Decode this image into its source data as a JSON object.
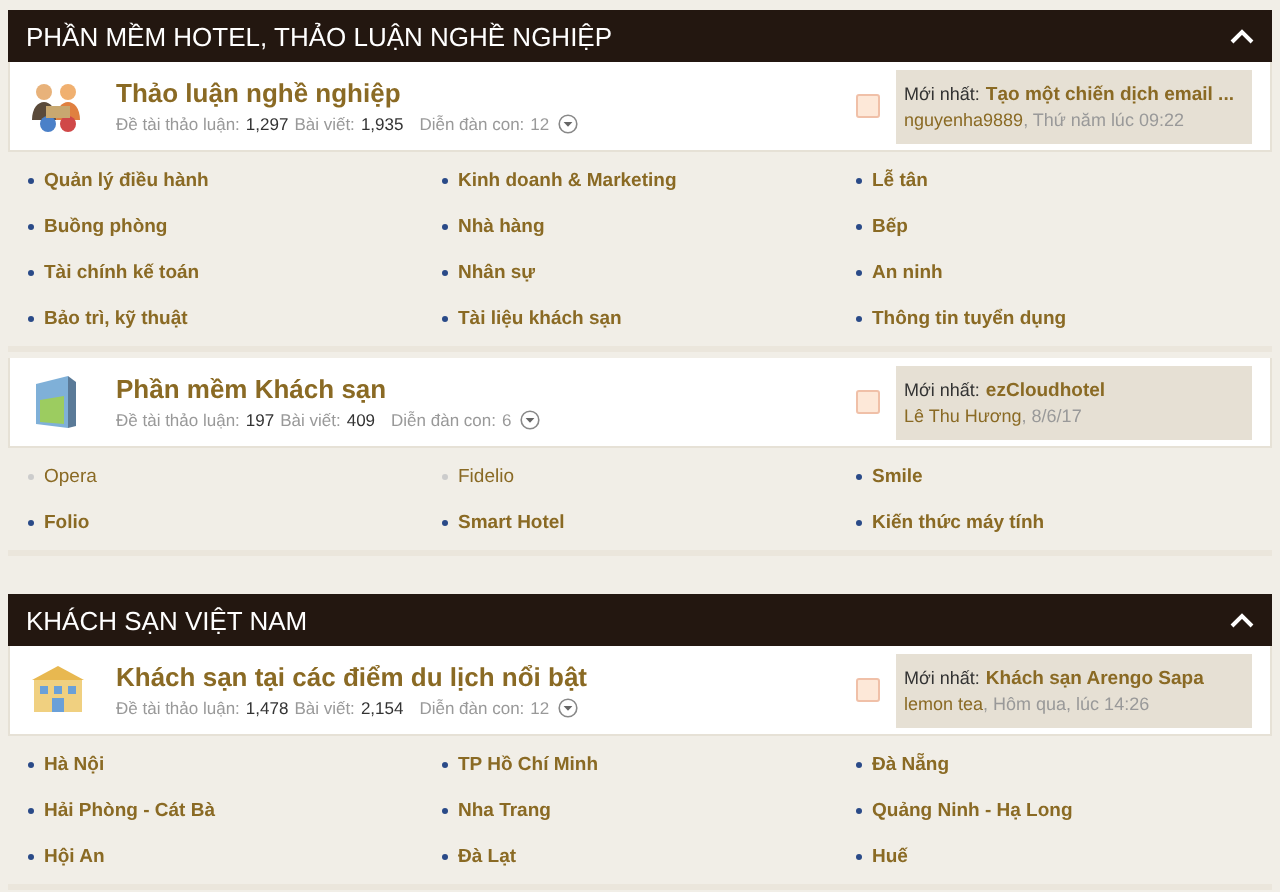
{
  "sections": [
    {
      "title": "PHẦN MỀM HOTEL, THẢO LUẬN NGHỀ NGHIỆP",
      "expanded": true,
      "forums": [
        {
          "kind": "people",
          "title": "Thảo luận nghề nghiệp",
          "stats": {
            "threads_label": "Đề tài thảo luận:",
            "threads": "1,297",
            "posts_label": "Bài viết:",
            "posts": "1,935",
            "subforums_label": "Diễn đàn con:",
            "subforums": "12"
          },
          "latest": {
            "label": "Mới nhất:",
            "title": "Tạo một chiến dịch email ...",
            "user": "nguyenha9889",
            "date": ", Thứ năm lúc 09:22"
          },
          "children": [
            {
              "label": "Quản lý điều hành",
              "unread": true
            },
            {
              "label": "Kinh doanh & Marketing",
              "unread": true
            },
            {
              "label": "Lễ tân",
              "unread": true
            },
            {
              "label": "Buồng phòng",
              "unread": true
            },
            {
              "label": "Nhà hàng",
              "unread": true
            },
            {
              "label": "Bếp",
              "unread": true
            },
            {
              "label": "Tài chính kế toán",
              "unread": true
            },
            {
              "label": "Nhân sự",
              "unread": true
            },
            {
              "label": "An ninh",
              "unread": true
            },
            {
              "label": "Bảo trì, kỹ thuật",
              "unread": true
            },
            {
              "label": "Tài liệu khách sạn",
              "unread": true
            },
            {
              "label": "Thông tin tuyển dụng",
              "unread": true
            }
          ]
        },
        {
          "kind": "window",
          "title": "Phần mềm Khách sạn",
          "stats": {
            "threads_label": "Đề tài thảo luận:",
            "threads": "197",
            "posts_label": "Bài viết:",
            "posts": "409",
            "subforums_label": "Diễn đàn con:",
            "subforums": "6"
          },
          "latest": {
            "label": "Mới nhất:",
            "title": "ezCloudhotel",
            "user": "Lê Thu Hương",
            "date": ", 8/6/17"
          },
          "children": [
            {
              "label": "Opera",
              "unread": false
            },
            {
              "label": "Fidelio",
              "unread": false
            },
            {
              "label": "Smile",
              "unread": true
            },
            {
              "label": "Folio",
              "unread": true
            },
            {
              "label": "Smart Hotel",
              "unread": true
            },
            {
              "label": "Kiến thức máy tính",
              "unread": true
            }
          ]
        }
      ]
    },
    {
      "title": "KHÁCH SẠN VIỆT NAM",
      "expanded": true,
      "forums": [
        {
          "kind": "building",
          "title": "Khách sạn tại các điểm du lịch nổi bật",
          "stats": {
            "threads_label": "Đề tài thảo luận:",
            "threads": "1,478",
            "posts_label": "Bài viết:",
            "posts": "2,154",
            "subforums_label": "Diễn đàn con:",
            "subforums": "12"
          },
          "latest": {
            "label": "Mới nhất:",
            "title": "Khách sạn Arengo Sapa",
            "user": "lemon tea",
            "date": ", Hôm qua, lúc 14:26"
          },
          "children": [
            {
              "label": "Hà Nội",
              "unread": true
            },
            {
              "label": "TP Hồ Chí Minh",
              "unread": true
            },
            {
              "label": "Đà Nẵng",
              "unread": true
            },
            {
              "label": "Hải Phòng - Cát Bà",
              "unread": true
            },
            {
              "label": "Nha Trang",
              "unread": true
            },
            {
              "label": "Quảng Ninh - Hạ Long",
              "unread": true
            },
            {
              "label": "Hội An",
              "unread": true
            },
            {
              "label": "Đà Lạt",
              "unread": true
            },
            {
              "label": "Huế",
              "unread": true
            }
          ]
        }
      ]
    }
  ]
}
